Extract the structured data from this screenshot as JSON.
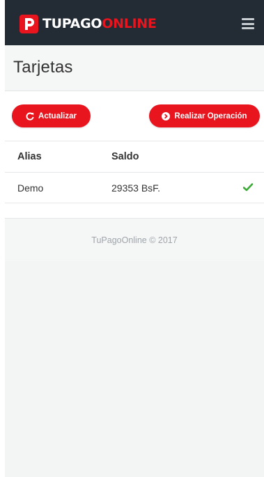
{
  "header": {
    "logo_text_white": "TUPAGO",
    "logo_text_red": "ONLINE",
    "logo_icon": "p-letter-icon",
    "menu_icon": "hamburger-icon",
    "brand_color": "#e8141e",
    "bar_color": "#232c34"
  },
  "page": {
    "title": "Tarjetas"
  },
  "actions": {
    "refresh_label": "Actualizar",
    "refresh_icon": "refresh-icon",
    "operation_label": "Realizar Operación",
    "operation_icon": "arrow-circle-right-icon"
  },
  "table": {
    "columns": [
      "Alias",
      "Saldo"
    ],
    "rows": [
      {
        "alias": "Demo",
        "saldo": "29353 BsF.",
        "status_icon": "check-icon",
        "status_color": "#3aaa35"
      }
    ]
  },
  "footer": {
    "text": "TuPagoOnline © 2017"
  }
}
